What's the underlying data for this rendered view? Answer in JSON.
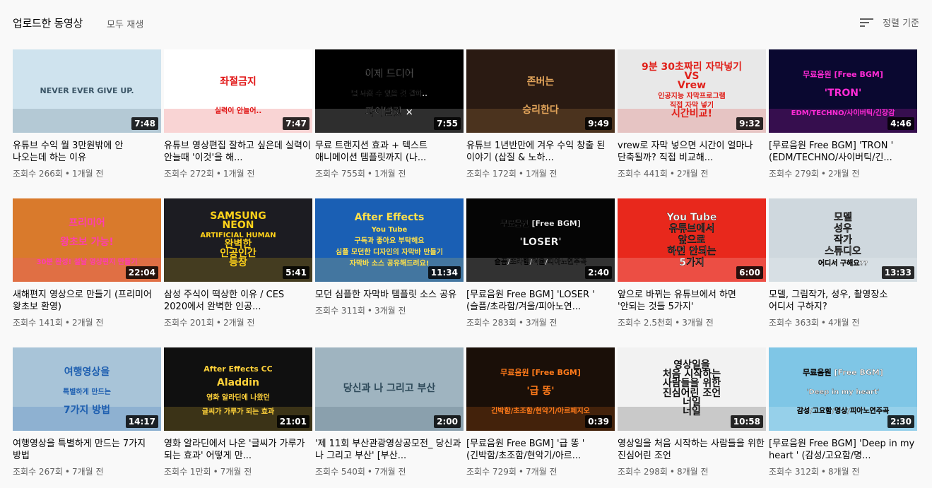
{
  "header": {
    "title": "업로드한 동영상",
    "play_all": "모두 재생",
    "sort_label": "정렬 기준",
    "sort_icon": "sort-icon"
  },
  "videos": [
    {
      "title": "유튜브 수익 월 3만원밖에 안 나오는데 하는 이유",
      "duration": "7:48",
      "views": "조회수 266회",
      "age": "1개월 전",
      "thumb_text": [
        "NEVER EVER GIVE UP."
      ],
      "colors": [
        "#cfe3ee",
        "#3b5566"
      ]
    },
    {
      "title": "유튜브 영상편집 잘하고 싶은데 실력이 안늘때 '이것'을 해...",
      "duration": "7:47",
      "views": "조회수 272회",
      "age": "1개월 전",
      "thumb_text": [
        "좌절금지",
        "실력이 안늘어.."
      ],
      "colors": [
        "#ffffff",
        "#e01010"
      ]
    },
    {
      "title": "무료 트랜지션 효과 + 텍스트 애니메이션 템플릿까지 (나...",
      "duration": "7:55",
      "views": "조회수 755회",
      "age": "1개월 전",
      "thumb_text": [
        "이제 드디어",
        "널 놔줄 수 있을 것 같아..",
        "파이널컷 ×"
      ],
      "colors": [
        "#000000",
        "#ffffff"
      ]
    },
    {
      "title": "유튜브 1년반만에 겨우 수익 창출 된 이야기 (삽질 & 노하...",
      "duration": "9:49",
      "views": "조회수 172회",
      "age": "1개월 전",
      "thumb_text": [
        "존버는",
        "승리한다"
      ],
      "colors": [
        "#2a1a12",
        "#e2a45a"
      ]
    },
    {
      "title": "vrew로 자막 넣으면 시간이 얼마나 단축될까? 직접 비교해...",
      "duration": "9:32",
      "views": "조회수 441회",
      "age": "2개월 전",
      "thumb_text": [
        "9분 30초짜리 자막넣기",
        "VS",
        "Vrew",
        "인공지능 자막프로그램",
        "직접 자막 넣기",
        "시간비교!"
      ],
      "colors": [
        "#e8e8e8",
        "#e0201a"
      ]
    },
    {
      "title": "[무료음원 Free BGM] 'TRON ' (EDM/TECHNO/사이버틱/긴...",
      "duration": "4:46",
      "views": "조회수 279회",
      "age": "2개월 전",
      "thumb_text": [
        "무료음원 [Free BGM]",
        "'TRON'",
        "EDM/TECHNO/사이버틱/긴장감"
      ],
      "colors": [
        "#0a0830",
        "#ff2bd6"
      ]
    },
    {
      "title": "새해편지 영상으로 만들기 (프리미어 왕초보 환영)",
      "duration": "22:04",
      "views": "조회수 141회",
      "age": "2개월 전",
      "thumb_text": [
        "프리미어",
        "왕초보 가능!",
        "30분 완성! 설날 영상편지 만들기"
      ],
      "colors": [
        "#d97a2c",
        "#ff3db0"
      ]
    },
    {
      "title": "삼성 주식이 떡상한 이유 / CES 2020에서 완벽한 인공...",
      "duration": "5:41",
      "views": "조회수 201회",
      "age": "2개월 전",
      "thumb_text": [
        "SAMSUNG",
        "NEON",
        "ARTIFICIAL HUMAN",
        "완벽한",
        "인공인간",
        "등장"
      ],
      "colors": [
        "#1c1c22",
        "#ffd21a"
      ]
    },
    {
      "title": "모던 심플한 자막바 템플릿 소스 공유",
      "duration": "11:34",
      "views": "조회수 311회",
      "age": "3개월 전",
      "thumb_text": [
        "After Effects",
        "You Tube",
        "구독과 좋아요 부탁해요",
        "심플 모던한 디자인의 자막바 만들기",
        "자막바 소스 공유해드려요!"
      ],
      "colors": [
        "#1a5fb4",
        "#ffe14a"
      ]
    },
    {
      "title": "[무료음원 Free BGM] 'LOSER ' (슬픔/초라함/겨울/피아노연...",
      "duration": "2:40",
      "views": "조회수 283회",
      "age": "3개월 전",
      "thumb_text": [
        "무료음원 [Free BGM]",
        "'LOSER'",
        "슬픔/초라함/겨울/피아노연주곡"
      ],
      "colors": [
        "#050505",
        "#ffffff"
      ]
    },
    {
      "title": "앞으로 바뀌는 유튜브에서 하면 '안되는 것들 5가지'",
      "duration": "6:00",
      "views": "조회수 2.5천회",
      "age": "3개월 전",
      "thumb_text": [
        "You Tube",
        "유튜브에서",
        "앞으로",
        "하면 안되는",
        "5가지"
      ],
      "colors": [
        "#e8281c",
        "#ffffff"
      ]
    },
    {
      "title": "모델, 그림작가, 성우, 촬영장소 어디서 구하지?",
      "duration": "13:33",
      "views": "조회수 363회",
      "age": "4개월 전",
      "thumb_text": [
        "모델",
        "성우",
        "작가",
        "스튜디오",
        "어디서 구해요??"
      ],
      "colors": [
        "#cfd8de",
        "#ffffff"
      ]
    },
    {
      "title": "여행영상을 특별하게 만드는 7가지 방법",
      "duration": "14:17",
      "views": "조회수 267회",
      "age": "7개월 전",
      "thumb_text": [
        "여행영상을",
        "특별하게 만드는",
        "7가지 방법"
      ],
      "colors": [
        "#a8c4d8",
        "#1e5fb0"
      ]
    },
    {
      "title": "영화 알라딘에서 나온 '글씨가 가루가 되는 효과' 어떻게 만...",
      "duration": "21:01",
      "views": "조회수 1만회",
      "age": "7개월 전",
      "thumb_text": [
        "After Effects CC",
        "Aladdin",
        "영화 알라딘에 나왔던",
        "글씨가 가루가 되는 효과"
      ],
      "colors": [
        "#101010",
        "#ffd23a"
      ]
    },
    {
      "title": "'제 11회 부산관광영상공모전_ 당신과 나 그리고 부산' [부산...",
      "duration": "2:00",
      "views": "조회수 540회",
      "age": "7개월 전",
      "thumb_text": [
        "당신과 나 그리고 부산"
      ],
      "colors": [
        "#9fb4c0",
        "#2e4a5a"
      ]
    },
    {
      "title": "[무료음원 Free BGM] '급 똥 ' (긴박함/초조함/현악기/아르...",
      "duration": "0:39",
      "views": "조회수 729회",
      "age": "7개월 전",
      "thumb_text": [
        "무료음원 [Free BGM]",
        "'급 똥'",
        "긴박함/초조함/현악기/아르페지오"
      ],
      "colors": [
        "#1a0f08",
        "#ff7a1a"
      ]
    },
    {
      "title": "영상일을 처음 시작하는 사람들을 위한 진심어린 조언",
      "duration": "10:58",
      "views": "조회수 298회",
      "age": "8개월 전",
      "thumb_text": [
        "영상일을",
        "처음 시작하는",
        "사람들을 위한",
        "진심어린 조언",
        "너일",
        "너일"
      ],
      "colors": [
        "#f2f2f2",
        "#111111"
      ]
    },
    {
      "title": "[무료음원 Free BGM] 'Deep in my heart ' (감성/고요함/명...",
      "duration": "2:30",
      "views": "조회수 312회",
      "age": "8개월 전",
      "thumb_text": [
        "무료음원 [Free BGM]",
        "'Deep in my heart'",
        "감성/고요함/명상/피아노연주곡"
      ],
      "colors": [
        "#7fc6e6",
        "#ffffff"
      ]
    }
  ]
}
